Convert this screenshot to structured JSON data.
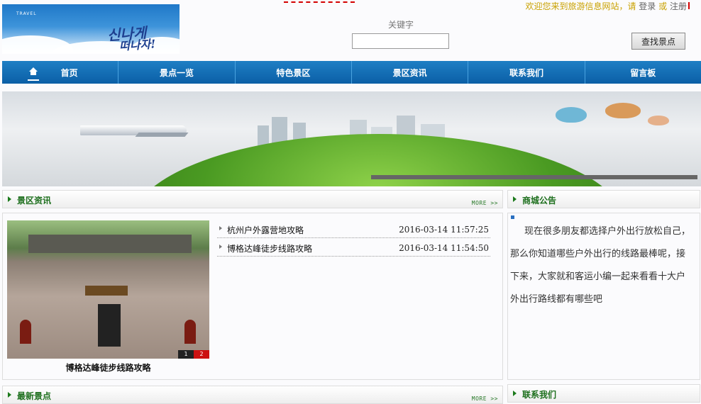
{
  "logo": {
    "brand": "TRAVEL",
    "script_line1": "신나게",
    "script_line2": "떠나자!"
  },
  "welcome": {
    "greeting": "欢迎您来到旅游信息网站，请",
    "login": "登录",
    "or": "或",
    "register": "注册"
  },
  "search": {
    "label": "关键字",
    "value": "",
    "button": "查找景点"
  },
  "nav": {
    "items": [
      "首页",
      "景点一览",
      "特色景区",
      "景区资讯",
      "联系我们",
      "留言板"
    ]
  },
  "panels": {
    "news": {
      "title": "景区资讯",
      "more": "MORE >>"
    },
    "notice": {
      "title": "商城公告"
    },
    "latest": {
      "title": "最新景点",
      "more": "MORE >>"
    },
    "contact": {
      "title": "联系我们"
    }
  },
  "slideshow": {
    "caption": "博格达峰徒步线路攻略",
    "pages": [
      "1",
      "2"
    ]
  },
  "news_items": [
    {
      "title": "杭州户外露营地攻略",
      "date": "2016-03-14 11:57:25"
    },
    {
      "title": "博格达峰徒步线路攻略",
      "date": "2016-03-14 11:54:50"
    }
  ],
  "notice_text": "现在很多朋友都选择户外出行放松自己，那么你知道哪些户外出行的线路最棒呢，接下来，大家就和客运小编一起来看看十大户外出行路线都有哪些吧",
  "colors": {
    "nav": "#0b5fa6",
    "panel_title": "#1d6f1d",
    "welcome": "#c9a100"
  }
}
